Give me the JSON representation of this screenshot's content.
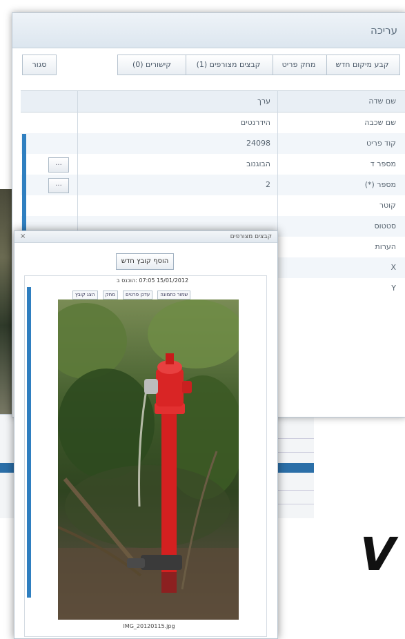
{
  "edit_window": {
    "title": "עריכה",
    "toolbar": {
      "new_location": "קבע מיקום חדש",
      "delete_item": "מחק פריט",
      "attached_files": "קבצים מצורפים (1)",
      "links": "קישורים (0)",
      "close": "סגור"
    },
    "grid": {
      "headers": {
        "field_name": "שם שדה",
        "value": "ערך"
      },
      "rows": [
        {
          "field": "שם שכבה",
          "value": "הידרנטים"
        },
        {
          "field": "קוד פריט",
          "value": "24098"
        },
        {
          "field": "מספר ד",
          "value": "הבוגנוב"
        },
        {
          "field": "מספר (*)",
          "value": "2"
        },
        {
          "field": "קוטר",
          "value": ""
        },
        {
          "field": "סטטוס",
          "value": ""
        },
        {
          "field": "הערות",
          "value": ""
        },
        {
          "field": "X",
          "value": ""
        },
        {
          "field": "Y",
          "value": ""
        }
      ],
      "row_button_label": "..."
    }
  },
  "image_window": {
    "title": "קבצים מצורפים",
    "close_glyph": "×",
    "add_file_button": "הוסף קובץ חדש",
    "file_meta": "15/01/2012 07:05 :הוכנס ב",
    "file_links": [
      "הצג קובץ",
      "מחק",
      "עדכן פרטים",
      "שמור כתמונה"
    ],
    "file_name": "IMG_20120115.jpg"
  },
  "colors": {
    "accent_blue": "#2f7fc0",
    "hydrant_red": "#d42020",
    "title_bg": "#dce6ef"
  }
}
